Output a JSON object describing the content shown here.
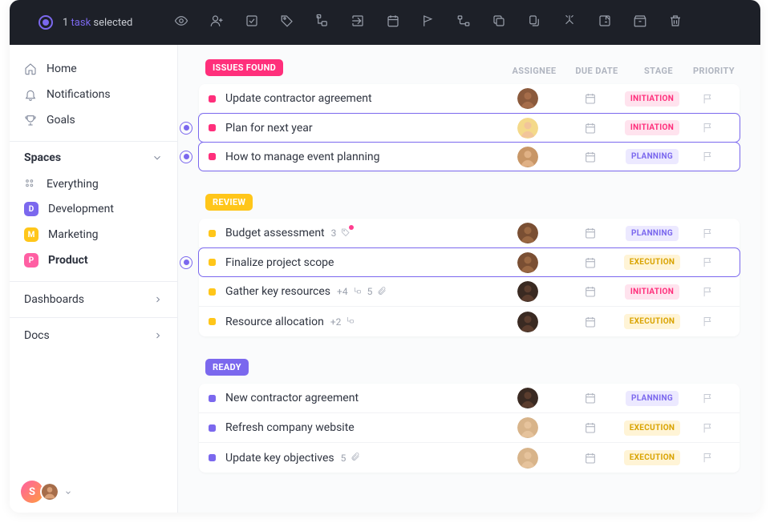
{
  "topbar": {
    "selection_count": "1",
    "selection_word": "task",
    "selection_suffix": "selected"
  },
  "sidebar": {
    "nav": [
      {
        "label": "Home"
      },
      {
        "label": "Notifications"
      },
      {
        "label": "Goals"
      }
    ],
    "spaces_header": "Spaces",
    "spaces": [
      {
        "letter": "",
        "label": "Everything",
        "color": ""
      },
      {
        "letter": "D",
        "label": "Development",
        "color": "#7b68ee"
      },
      {
        "letter": "M",
        "label": "Marketing",
        "color": "#ffc61a"
      },
      {
        "letter": "P",
        "label": "Product",
        "color": "#ff5fa3"
      }
    ],
    "dashboards": "Dashboards",
    "docs": "Docs",
    "workspace_letter": "S"
  },
  "columns": {
    "assignee": "ASSIGNEE",
    "due": "DUE DATE",
    "stage": "STAGE",
    "priority": "PRIORITY"
  },
  "groups": [
    {
      "name": "ISSUES FOUND",
      "color": "#ff2f7b",
      "status_color": "#ff2f7b",
      "tasks": [
        {
          "title": "Update contractor agreement",
          "selected": false,
          "stage": "INITIATION",
          "stage_class": "stage-initiation",
          "assignee_bg": "#8b5a3c",
          "assignee_skin": "#a66d4a"
        },
        {
          "title": "Plan for next year",
          "selected": true,
          "stage": "INITIATION",
          "stage_class": "stage-initiation",
          "assignee_bg": "#f4d98a",
          "assignee_skin": "#f2c59a"
        },
        {
          "title": "How to manage event planning",
          "selected": true,
          "stage": "PLANNING",
          "stage_class": "stage-planning",
          "assignee_bg": "#c89666",
          "assignee_skin": "#e0b185"
        }
      ]
    },
    {
      "name": "REVIEW",
      "color": "#ffc61a",
      "status_color": "#ffc61a",
      "tasks": [
        {
          "title": "Budget assessment",
          "selected": false,
          "stage": "PLANNING",
          "stage_class": "stage-planning",
          "assignee_bg": "#7a4f33",
          "assignee_skin": "#9a6843",
          "meta_count": "3",
          "meta_tag_pulse": true
        },
        {
          "title": "Finalize project scope",
          "selected": true,
          "stage": "EXECUTION",
          "stage_class": "stage-execution",
          "assignee_bg": "#7a4f33",
          "assignee_skin": "#9a6843"
        },
        {
          "title": "Gather key resources",
          "selected": false,
          "stage": "INITIATION",
          "stage_class": "stage-initiation",
          "assignee_bg": "#3a2a22",
          "assignee_skin": "#5b3d2e",
          "meta_subtasks": "+4",
          "meta_attach": "5"
        },
        {
          "title": "Resource allocation",
          "selected": false,
          "stage": "EXECUTION",
          "stage_class": "stage-execution",
          "assignee_bg": "#3a2a22",
          "assignee_skin": "#5b3d2e",
          "meta_subtasks": "+2"
        }
      ]
    },
    {
      "name": "READY",
      "color": "#7b68ee",
      "status_color": "#7b68ee",
      "tasks": [
        {
          "title": "New contractor agreement",
          "selected": false,
          "stage": "PLANNING",
          "stage_class": "stage-planning",
          "assignee_bg": "#3a2a22",
          "assignee_skin": "#5b3d2e"
        },
        {
          "title": "Refresh company website",
          "selected": false,
          "stage": "EXECUTION",
          "stage_class": "stage-execution",
          "assignee_bg": "#d8b48a",
          "assignee_skin": "#e6c39c"
        },
        {
          "title": "Update key objectives",
          "selected": false,
          "stage": "EXECUTION",
          "stage_class": "stage-execution",
          "assignee_bg": "#d8b48a",
          "assignee_skin": "#e6c39c",
          "meta_attach": "5"
        }
      ]
    }
  ]
}
